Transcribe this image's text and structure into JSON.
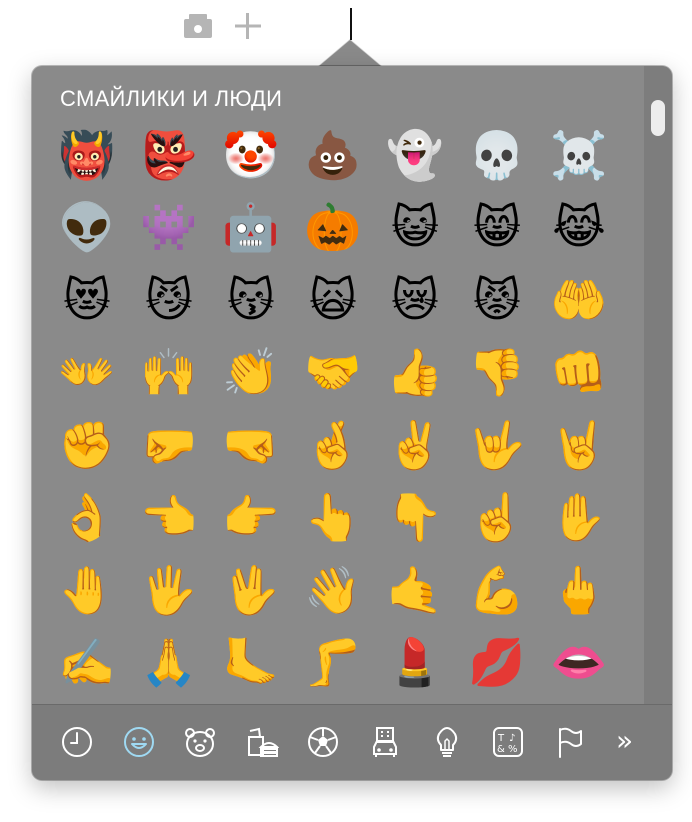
{
  "popover": {
    "section_title": "СМАЙЛИКИ И ЛЮДИ",
    "more_label": "»"
  },
  "emoji_rows": [
    [
      "😁",
      "😆",
      "😖",
      "🤑",
      "😀",
      "😈",
      "👿"
    ],
    [
      "👹",
      "👺",
      "🤡",
      "💩",
      "👻",
      "💀",
      "☠️"
    ],
    [
      "👽",
      "👾",
      "🤖",
      "🎃",
      "😺",
      "😸",
      "😹"
    ],
    [
      "😻",
      "😼",
      "😽",
      "🙀",
      "😿",
      "😾",
      "🤲"
    ],
    [
      "👐",
      "🙌",
      "👏",
      "🤝",
      "👍",
      "👎",
      "👊"
    ],
    [
      "✊",
      "🤛",
      "🤜",
      "🤞",
      "✌️",
      "🤟",
      "🤘"
    ],
    [
      "👌",
      "👈",
      "👉",
      "👆",
      "👇",
      "☝️",
      "✋"
    ],
    [
      "🤚",
      "🖐️",
      "🖖",
      "👋",
      "🤙",
      "💪",
      "🖕"
    ],
    [
      "✍️",
      "🙏",
      "🦶",
      "🦵",
      "💄",
      "💋",
      "👄"
    ]
  ],
  "categories": [
    {
      "name": "frequently-used",
      "icon": "clock-icon"
    },
    {
      "name": "smileys-people",
      "icon": "smiley-icon",
      "active": true
    },
    {
      "name": "animals-nature",
      "icon": "bear-icon"
    },
    {
      "name": "food-drink",
      "icon": "food-icon"
    },
    {
      "name": "activity",
      "icon": "soccer-ball-icon"
    },
    {
      "name": "travel-places",
      "icon": "car-building-icon"
    },
    {
      "name": "objects",
      "icon": "lightbulb-icon"
    },
    {
      "name": "symbols",
      "icon": "symbols-icon"
    },
    {
      "name": "flags",
      "icon": "flag-icon"
    }
  ],
  "colors": {
    "popover_bg": "#8a8a8a",
    "footer_bg": "#7c7c7c",
    "active_category": "#9fd9f2",
    "icon_white": "#ffffff",
    "toolbar_icon": "#b5b5b5"
  }
}
